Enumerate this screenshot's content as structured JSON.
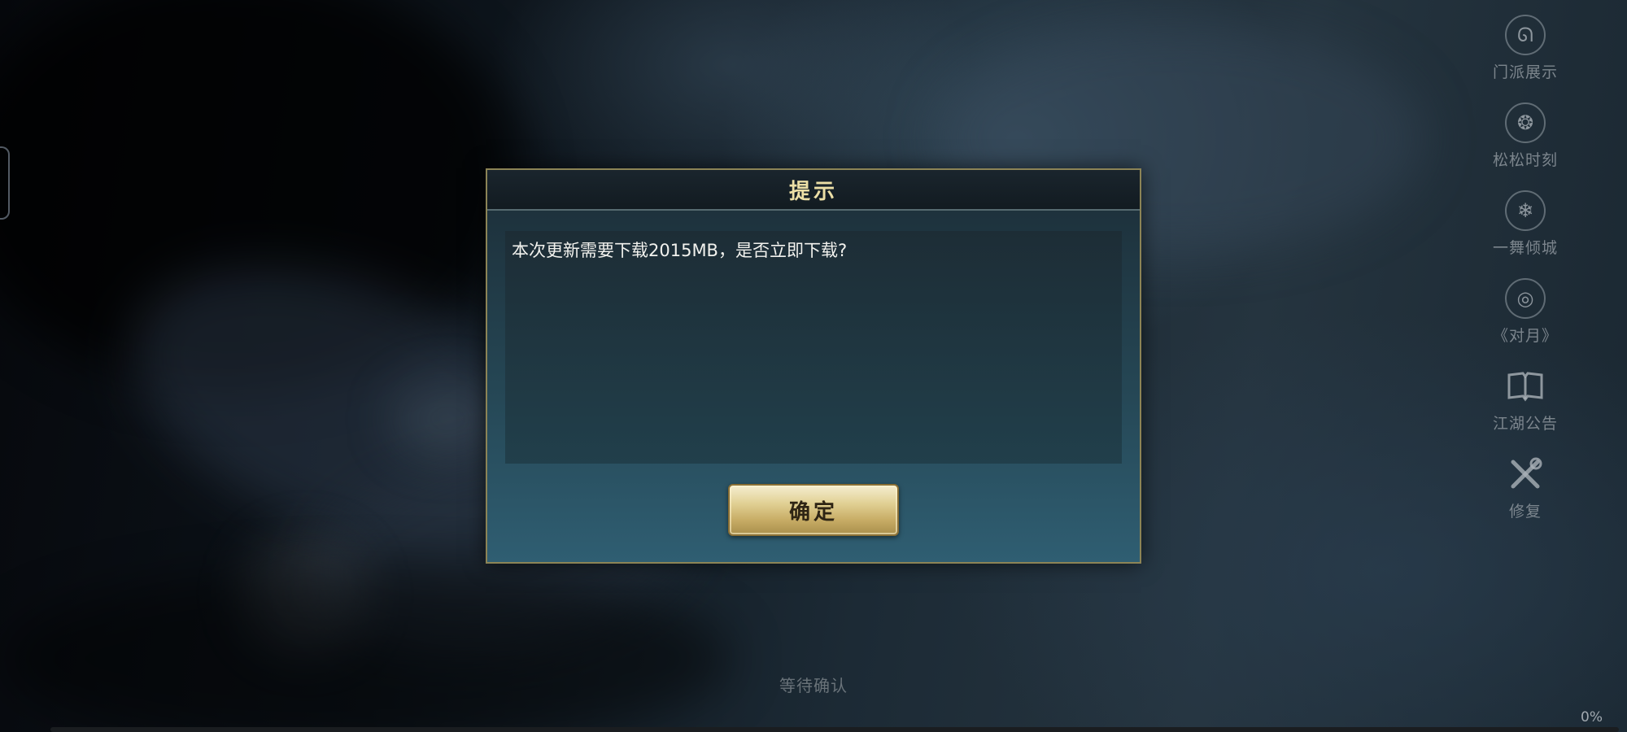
{
  "side_menu": {
    "items": [
      {
        "label": "门派展示",
        "icon": "sect-swirl-icon",
        "glyph": "ᘏ"
      },
      {
        "label": "松松时刻",
        "icon": "pinecone-icon",
        "glyph": "❂"
      },
      {
        "label": "一舞倾城",
        "icon": "snowflake-icon",
        "glyph": "❄"
      },
      {
        "label": "《对月》",
        "icon": "moon-swirl-icon",
        "glyph": "◎"
      },
      {
        "label": "江湖公告",
        "icon": "open-book-icon",
        "glyph": "📖"
      },
      {
        "label": "修复",
        "icon": "wrench-icon",
        "glyph": "✕"
      }
    ]
  },
  "dialog": {
    "title": "提示",
    "message": "本次更新需要下载2015MB，是否立即下载?",
    "confirm_label": "确定"
  },
  "status": {
    "text": "等待确认",
    "progress_label": "0%",
    "progress_value": 0
  },
  "colors": {
    "dialog_border": "#8c8456",
    "title_text": "#ecdfa6",
    "button_gold": "#d9c483"
  }
}
